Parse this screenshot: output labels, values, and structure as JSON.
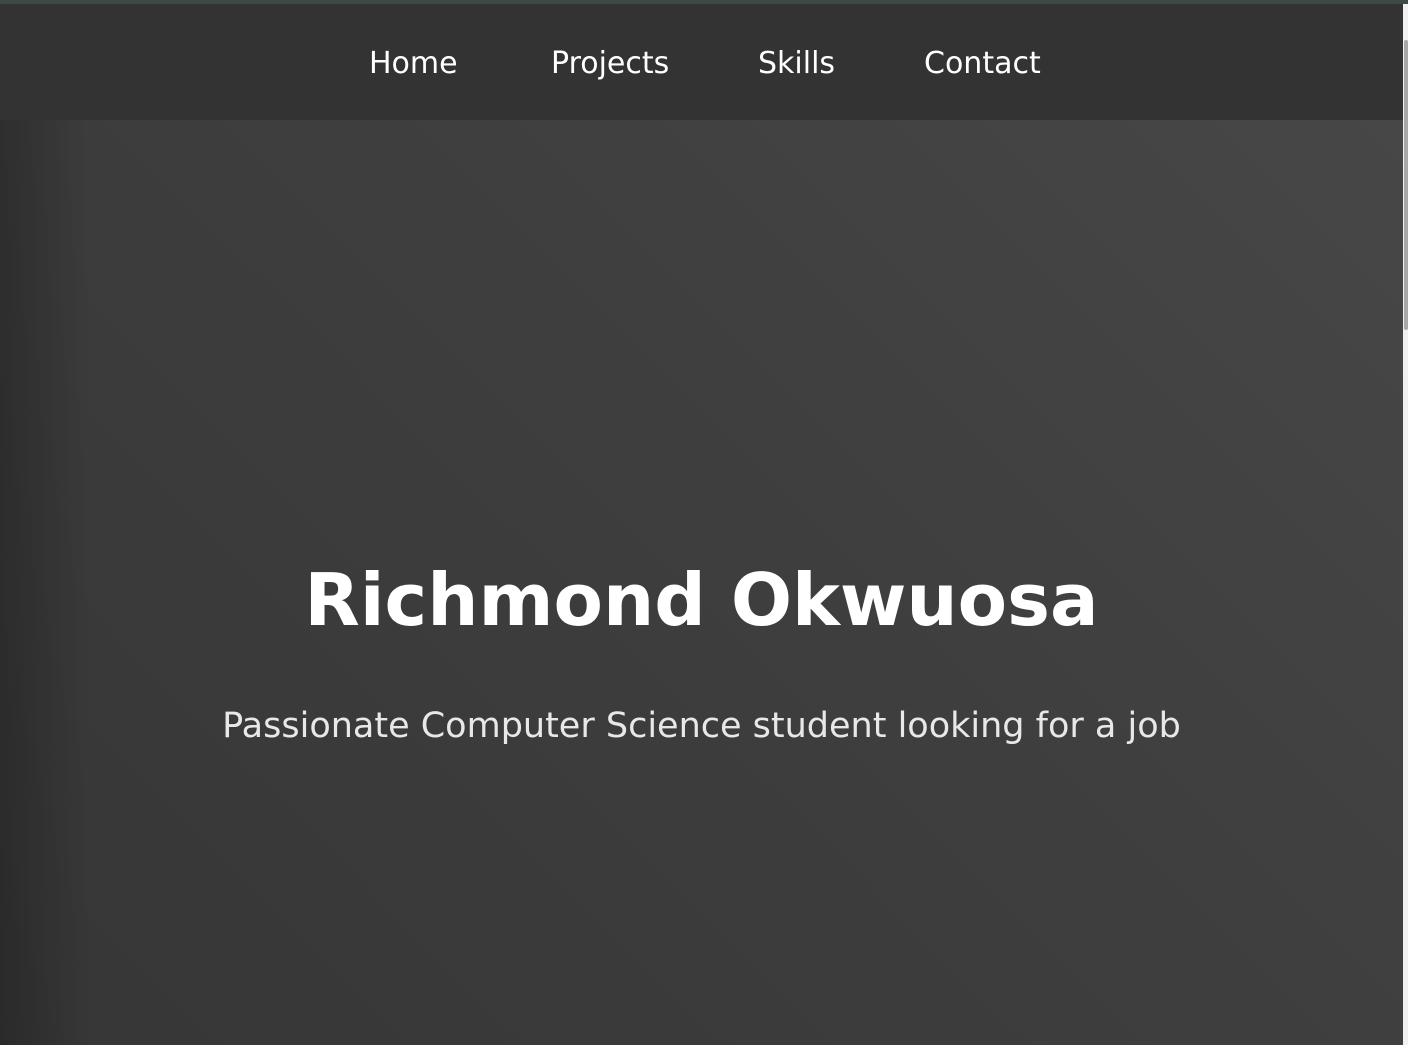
{
  "nav": {
    "items": [
      {
        "label": "Home"
      },
      {
        "label": "Projects"
      },
      {
        "label": "Skills"
      },
      {
        "label": "Contact"
      }
    ]
  },
  "hero": {
    "title": "Richmond Okwuosa",
    "subtitle": "Passionate Computer Science student looking for a job"
  },
  "colors": {
    "navbar_background": "#333333",
    "hero_background": "#3f3f3f",
    "text": "#ffffff"
  }
}
